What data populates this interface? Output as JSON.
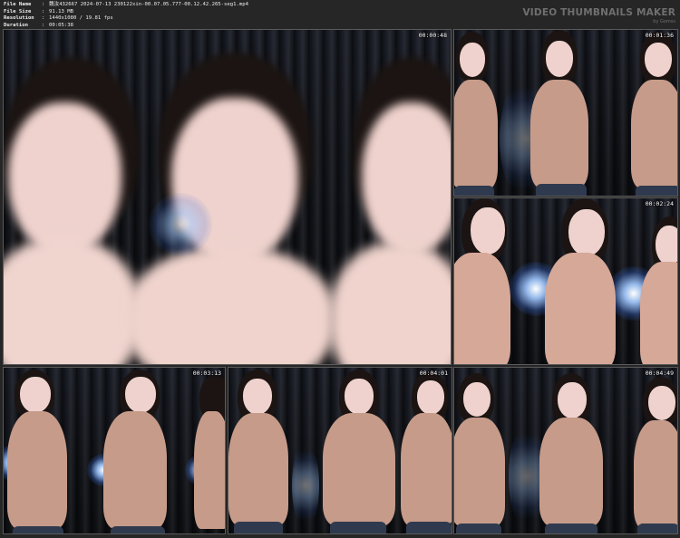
{
  "header": {
    "rows": [
      {
        "label": "File Name",
        "value": "魏汝432667 2024-07-13 230122xin-00.07.05.777-00.12.42.265-seg1.mp4"
      },
      {
        "label": "File Size",
        "value": "91.13 MB"
      },
      {
        "label": "Resolution",
        "value": "1440x1080 / 19.81 fps"
      },
      {
        "label": "Duration",
        "value": "00:05:38"
      }
    ],
    "brand": "VIDEO THUMBNAILS MAKER",
    "brand_sub": "by Gomss"
  },
  "thumbnails": [
    {
      "timestamp": "00:00:48"
    },
    {
      "timestamp": "00:01:36"
    },
    {
      "timestamp": "00:02:24"
    },
    {
      "timestamp": "00:03:13"
    },
    {
      "timestamp": "00:04:01"
    },
    {
      "timestamp": "00:04:49"
    }
  ]
}
